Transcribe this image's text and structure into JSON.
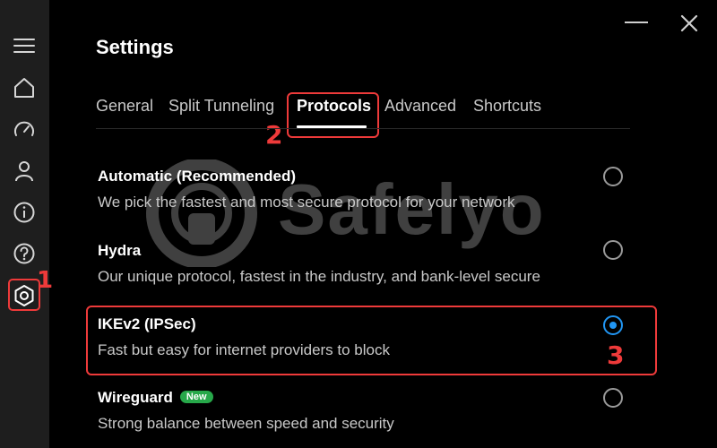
{
  "window": {
    "title": "Settings"
  },
  "sidebar": {
    "items": [
      {
        "icon": "menu-icon"
      },
      {
        "icon": "home-icon"
      },
      {
        "icon": "speed-icon"
      },
      {
        "icon": "account-icon"
      },
      {
        "icon": "info-icon"
      },
      {
        "icon": "help-icon"
      },
      {
        "icon": "settings-icon"
      }
    ]
  },
  "tabs": [
    {
      "label": "General"
    },
    {
      "label": "Split Tunneling"
    },
    {
      "label": "Protocols",
      "active": true
    },
    {
      "label": "Advanced"
    },
    {
      "label": "Shortcuts"
    }
  ],
  "options": [
    {
      "title": "Automatic (Recommended)",
      "description": "We pick the fastest and most secure protocol for your network",
      "selected": false
    },
    {
      "title": "Hydra",
      "description": "Our unique protocol, fastest in the industry, and bank-level secure",
      "selected": false
    },
    {
      "title": "IKEv2 (IPSec)",
      "description": "Fast but easy for internet providers to block",
      "selected": true
    },
    {
      "title": "Wireguard",
      "badge": "New",
      "description": "Strong balance between speed and security",
      "selected": false
    }
  ],
  "annotations": {
    "step1": "1",
    "step2": "2",
    "step3": "3"
  },
  "watermark": {
    "text": "Safelyo"
  },
  "colors": {
    "accent": "#2196f3",
    "highlight": "#ee3a3a",
    "badge": "#27a84a",
    "sidebar": "#1e1e1e",
    "background": "#000000"
  }
}
